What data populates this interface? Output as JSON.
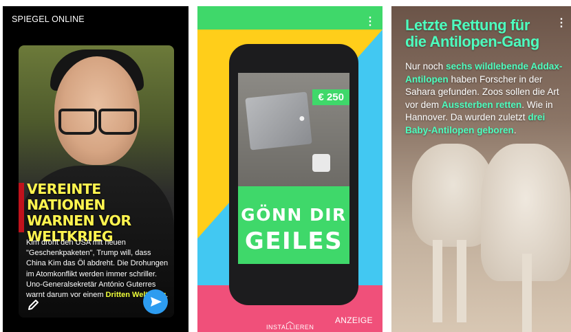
{
  "panel1": {
    "brand": "SPIEGEL ONLINE",
    "headline": "VEREINTE NATIONEN WARNEN VOR WELTKRIEG",
    "body_prefix": "Kim droht den USA mit neuen \"Geschenkpaketen\", Trump will, dass China Kim das Öl abdreht. Die Drohungen im Atomkonflikt werden immer schriller. Uno-Generalsekretär António Guterres warnt darum vor einem ",
    "body_highlight": "Dritten Weltkrieg",
    "body_suffix": ".",
    "highlight_color": "#f0ff3a",
    "accent_bar_color": "#c0121c",
    "send_button_color": "#2d9cf0"
  },
  "panel2": {
    "price": "€ 250",
    "slogan_line1": "GÖNN DIR",
    "slogan_line2": "GEILES",
    "install_label": "INSTALLIEREN",
    "ad_label": "ANZEIGE",
    "menu_glyph": "⋮",
    "colors": {
      "green": "#3fd86a",
      "yellow": "#ffce1a",
      "blue": "#42c8f2",
      "pink": "#f0507a"
    }
  },
  "panel3": {
    "title": "Letzte Rettung für die Antilopen-Gang",
    "body_parts": [
      {
        "text": "Nur noch ",
        "hl": false
      },
      {
        "text": "sechs wildlebende Addax-Antilopen",
        "hl": true
      },
      {
        "text": " haben Forscher in der Sahara gefunden. Zoos sollen die Art vor dem ",
        "hl": false
      },
      {
        "text": "Aussterben retten",
        "hl": true
      },
      {
        "text": ". Wie in Hannover. Da wurden zuletzt ",
        "hl": false
      },
      {
        "text": "drei Baby-Antilopen geboren",
        "hl": true
      },
      {
        "text": ".",
        "hl": false
      }
    ],
    "menu_glyph": "⋮",
    "highlight_color": "#4dffbf"
  }
}
